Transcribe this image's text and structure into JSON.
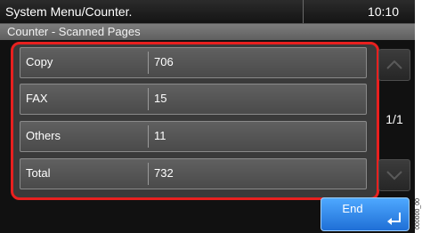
{
  "header": {
    "title": "System Menu/Counter.",
    "time": "10:10"
  },
  "subheader": {
    "title": "Counter - Scanned Pages"
  },
  "counters": [
    {
      "label": "Copy",
      "value": "706"
    },
    {
      "label": "FAX",
      "value": "15"
    },
    {
      "label": "Others",
      "value": "11"
    },
    {
      "label": "Total",
      "value": "732"
    }
  ],
  "pager": {
    "indicator": "1/1",
    "up_icon": "chevron-up-icon",
    "down_icon": "chevron-down-icon"
  },
  "footer": {
    "end_label": "End",
    "end_icon": "enter-icon"
  },
  "colors": {
    "highlight": "#e8201f",
    "end_button": "#2f86e8"
  }
}
